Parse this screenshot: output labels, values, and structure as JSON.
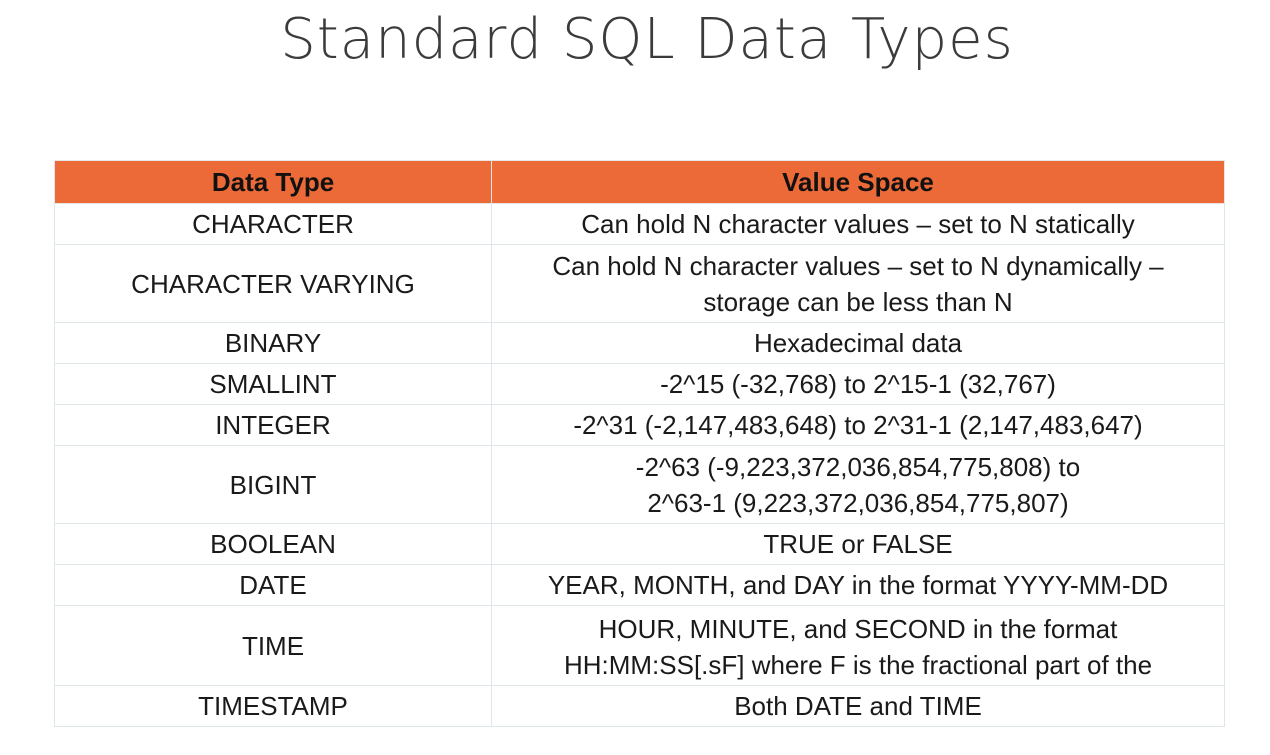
{
  "slide": {
    "title": "Standard SQL Data Types"
  },
  "table": {
    "headers": [
      "Data Type",
      "Value Space"
    ],
    "rows": [
      {
        "type": "CHARACTER",
        "value": "Can hold N character values – set to N statically"
      },
      {
        "type": "CHARACTER VARYING",
        "value": "Can hold N character values – set to N dynamically –\nstorage can be less than N"
      },
      {
        "type": "BINARY",
        "value": "Hexadecimal data"
      },
      {
        "type": "SMALLINT",
        "value": "-2^15 (-32,768) to 2^15-1 (32,767)"
      },
      {
        "type": "INTEGER",
        "value": "-2^31 (-2,147,483,648) to 2^31-1 (2,147,483,647)"
      },
      {
        "type": "BIGINT",
        "value": "-2^63 (-9,223,372,036,854,775,808) to\n2^63-1 (9,223,372,036,854,775,807)"
      },
      {
        "type": "BOOLEAN",
        "value": "TRUE or FALSE"
      },
      {
        "type": "DATE",
        "value": "YEAR, MONTH, and DAY in the format YYYY-MM-DD"
      },
      {
        "type": "TIME",
        "value": "HOUR, MINUTE, and SECOND in the format\nHH:MM:SS[.sF] where F is the fractional part of the"
      },
      {
        "type": "TIMESTAMP",
        "value": "Both DATE and TIME"
      }
    ]
  },
  "colors": {
    "header_background": "#ec6a37",
    "title_text": "#3b3b3b",
    "cell_border": "#dfe6ea"
  }
}
